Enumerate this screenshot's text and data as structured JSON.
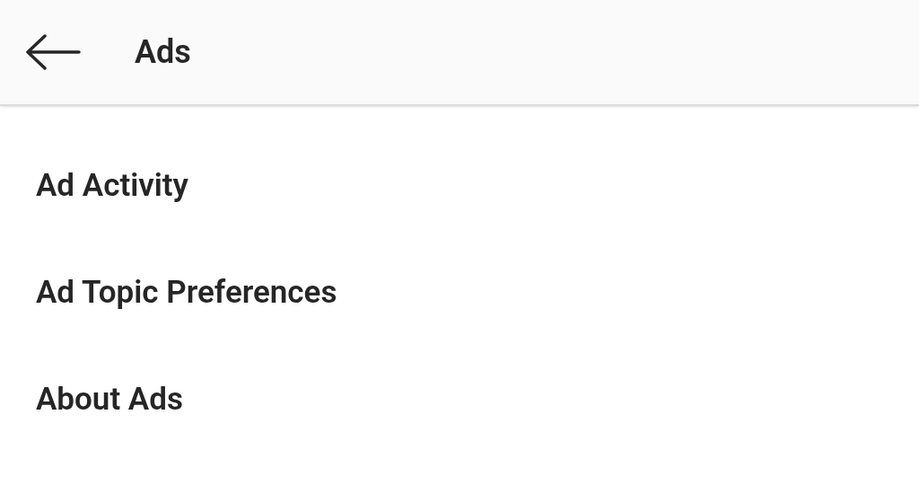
{
  "header": {
    "title": "Ads"
  },
  "menu": {
    "items": [
      {
        "label": "Ad Activity"
      },
      {
        "label": "Ad Topic Preferences"
      },
      {
        "label": "About Ads"
      }
    ]
  }
}
